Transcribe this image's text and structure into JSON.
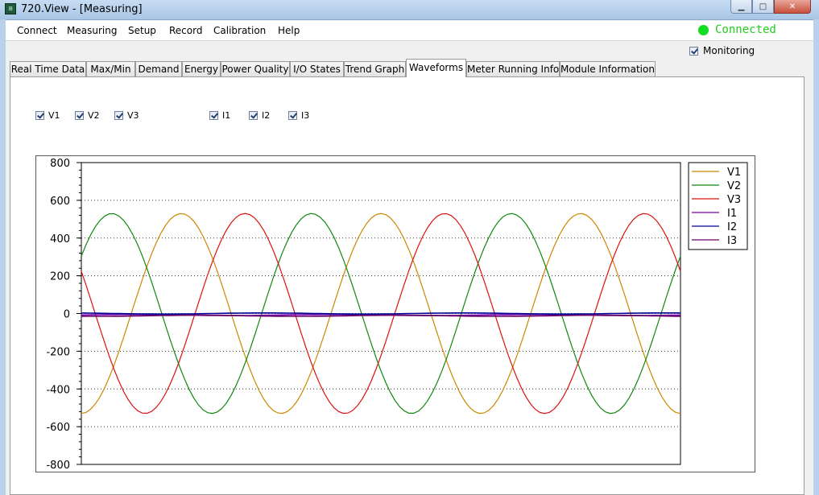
{
  "window": {
    "title": "720.View - [Measuring]",
    "icon": "app-icon",
    "buttons": [
      "minimize-icon",
      "maximize-icon",
      "close-icon"
    ]
  },
  "menu": {
    "items": [
      "Connect",
      "Measuring",
      "Setup",
      "Record",
      "Calibration",
      "Help"
    ]
  },
  "status": {
    "connection": "Connected",
    "connection_color": "#22cc22",
    "monitoring_label": "Monitoring",
    "monitoring_checked": true
  },
  "tabs": {
    "items": [
      "Real Time Data",
      "Max/Min",
      "Demand",
      "Energy",
      "Power Quality",
      "I/O States",
      "Trend Graph",
      "Waveforms",
      "Meter Running Info",
      "Module Information"
    ],
    "active": "Waveforms"
  },
  "channels": {
    "voltage": [
      {
        "label": "V1",
        "checked": true
      },
      {
        "label": "V2",
        "checked": true
      },
      {
        "label": "V3",
        "checked": true
      }
    ],
    "current": [
      {
        "label": "I1",
        "checked": true
      },
      {
        "label": "I2",
        "checked": true
      },
      {
        "label": "I3",
        "checked": true
      }
    ]
  },
  "chart_data": {
    "type": "line",
    "title": "",
    "xlabel": "",
    "ylabel": "",
    "ylim": [
      -800,
      800
    ],
    "yticks": [
      "800",
      "600",
      "400",
      "200",
      "0",
      "-200",
      "-400",
      "-600",
      "-800"
    ],
    "grid": true,
    "legend_position": "right",
    "x_cycles": 3,
    "samples": 128,
    "series": [
      {
        "name": "V1",
        "color": "#cc8800",
        "amplitude": 530,
        "phase_deg": 270
      },
      {
        "name": "V2",
        "color": "#118811",
        "amplitude": 530,
        "phase_deg": 35
      },
      {
        "name": "V3",
        "color": "#dd1111",
        "amplitude": 530,
        "phase_deg": 155
      },
      {
        "name": "I1",
        "color": "#7700aa",
        "amplitude": 3,
        "phase_deg": 0,
        "offset": -8
      },
      {
        "name": "I2",
        "color": "#000099",
        "amplitude": 3,
        "phase_deg": 120,
        "offset": 0
      },
      {
        "name": "I3",
        "color": "#660066",
        "amplitude": 3,
        "phase_deg": 240,
        "offset": -12
      }
    ]
  }
}
